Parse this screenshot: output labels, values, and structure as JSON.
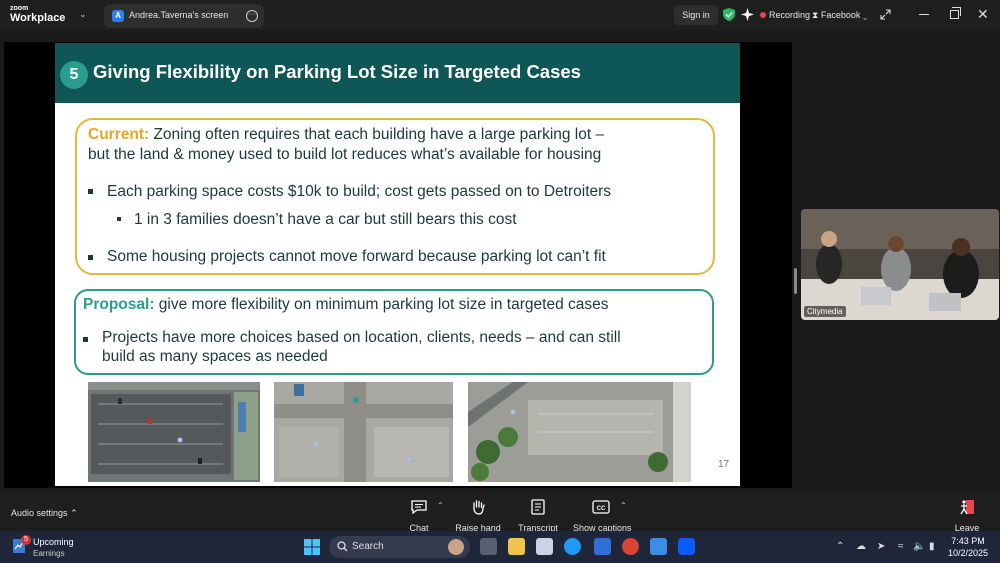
{
  "titlebar": {
    "brand_top": "zoom",
    "brand_bottom": "Workplace",
    "tab_avatar": "A",
    "tab_label": "Andrea.Taverna's screen",
    "signin": "Sign in",
    "recording": "Recording",
    "livestream": "Facebook"
  },
  "slide": {
    "number": "5",
    "title": "Giving Flexibility on Parking Lot Size in Targeted Cases",
    "current_lead": "Current:",
    "current_line1": " Zoning often requires that each building have a large parking lot –",
    "current_line2": "but the land & money used to build lot reduces what’s available for housing",
    "bullet1": "Each parking space costs $10k to build; cost gets passed on to Detroiters",
    "subbullet1": "1 in 3 families doesn’t have a car but still bears this cost",
    "bullet2": "Some housing projects cannot move forward because parking lot can’t fit",
    "proposal_lead": "Proposal:",
    "proposal_text": " give more flexibility on minimum parking lot size in targeted cases",
    "bullet3_line1": "Projects have more choices based on location, clients, needs – and can still",
    "bullet3_line2": "build as many spaces as needed",
    "page_number": "17"
  },
  "video": {
    "name": "Citymedia"
  },
  "toolbar": {
    "audio_settings": "Audio settings",
    "chat": "Chat",
    "raise_hand": "Raise hand",
    "transcript": "Transcript",
    "captions": "Show captions",
    "leave": "Leave"
  },
  "taskbar": {
    "weather_badge": "5",
    "weather_title": "Upcoming",
    "weather_sub": "Earnings",
    "search": "Search",
    "time": "7:43 PM",
    "date": "10/2/2025"
  },
  "colors": {
    "slide_header": "#0f5656",
    "current_accent": "#e4b73d",
    "proposal_accent": "#2a9d8f",
    "recording_dot": "#e5484d"
  }
}
